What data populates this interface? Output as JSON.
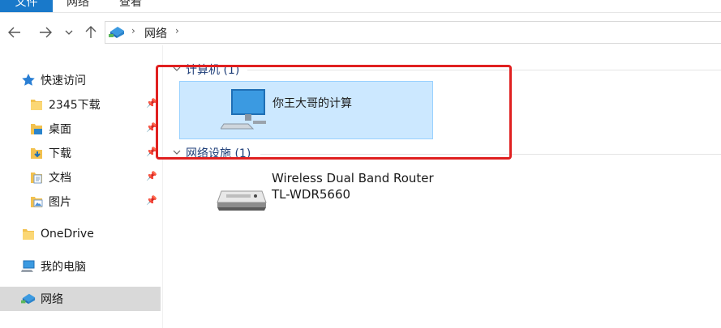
{
  "ribbon": {
    "tabs": [
      "文件",
      "网络",
      "查看"
    ]
  },
  "address": {
    "crumb": "网络"
  },
  "sidebar": {
    "quick_access": "快速访问",
    "items": [
      {
        "label": "2345下载"
      },
      {
        "label": "桌面"
      },
      {
        "label": "下载"
      },
      {
        "label": "文档"
      },
      {
        "label": "图片"
      }
    ],
    "onedrive": "OneDrive",
    "this_pc": "我的电脑",
    "network": "网络"
  },
  "content": {
    "group_computers": "计算机 (1)",
    "computer_name": "你王大哥的计算",
    "group_network": "网络设施 (1)",
    "router_line1": "Wireless Dual Band Router",
    "router_line2": "TL-WDR5660"
  }
}
